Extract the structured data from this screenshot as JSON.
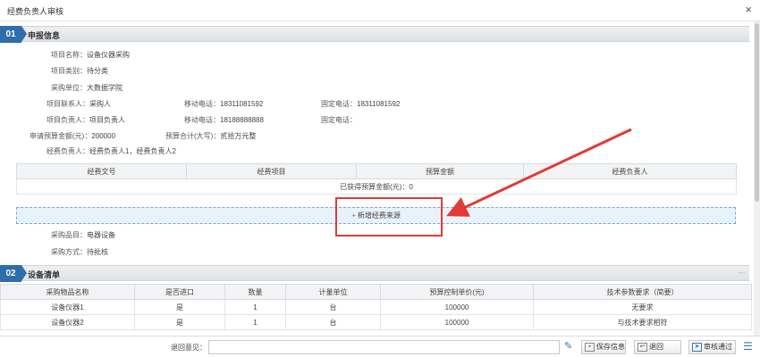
{
  "window": {
    "title": "经费负责人审核",
    "close_icon": "×"
  },
  "section1": {
    "num": "01",
    "title": "申报信息",
    "fields": {
      "project_name_k": "项目名称：",
      "project_name_v": "设备仪器采购",
      "project_type_k": "项目类别：",
      "project_type_v": "待分类",
      "purchase_unit_k": "采购单位：",
      "purchase_unit_v": "大数据学院",
      "contact_k": "项目联系人：",
      "contact_v": "采购人",
      "contact_mobile_k": "移动电话：",
      "contact_mobile_v": "18311081592",
      "contact_phone_k": "固定电话：",
      "contact_phone_v": "18311081592",
      "leader_k": "项目负责人：",
      "leader_v": "项目负责人",
      "leader_mobile_k": "移动电话：",
      "leader_mobile_v": "18188888888",
      "leader_phone_k": "固定电话：",
      "leader_phone_v": "",
      "budget_k": "申请预算金额(元)：",
      "budget_v": "200000",
      "budget_cap_k": "预算合计(大写)：",
      "budget_cap_v": "贰拾万元整",
      "funds_owner_k": "经费负责人：",
      "funds_owner_v": "经费负责人1，经费负责人2"
    },
    "funds_table": {
      "headers": [
        "经费文号",
        "经费项目",
        "预算金额",
        "经费负责人"
      ],
      "total": "已获得预算金额(元)：0"
    },
    "add_source_label": "新增经费来源",
    "purchase_item_k": "采购品目：",
    "purchase_item_v": "电器设备",
    "purchase_method_k": "采购方式：",
    "purchase_method_v": "待批核"
  },
  "section2": {
    "num": "02",
    "title": "设备清单",
    "collapse_icon": "—",
    "headers": [
      "采购物品名称",
      "是否进口",
      "数量",
      "计量单位",
      "预算控制单价(元)",
      "技术参数要求（简要）"
    ],
    "rows": [
      [
        "设备仪器1",
        "是",
        "1",
        "台",
        "100000",
        "无要求"
      ],
      [
        "设备仪器2",
        "是",
        "1",
        "台",
        "100000",
        "与技术要求相符"
      ]
    ]
  },
  "footer": {
    "opinion_label": "退回意见：",
    "opinion_value": "",
    "save_label": "保存信息",
    "back_label": "退回",
    "approve_label": "审核通过"
  },
  "colors": {
    "accent": "#2f6dab",
    "annotation": "#e03b36",
    "success": "#2e9a3a"
  }
}
